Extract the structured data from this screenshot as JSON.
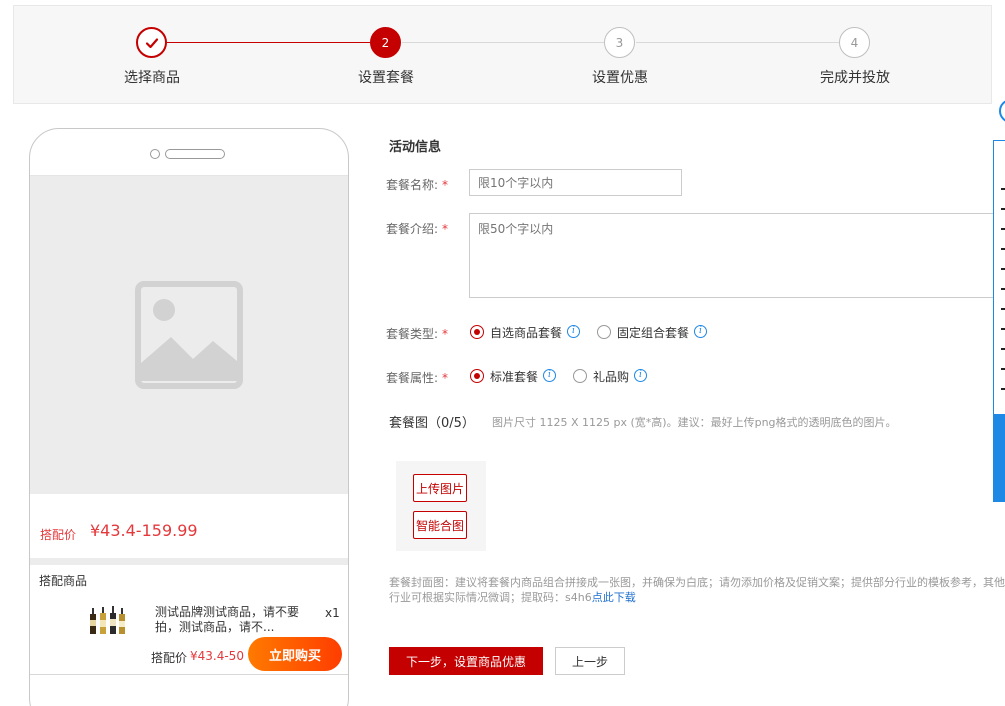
{
  "steps": [
    {
      "num": "",
      "label": "选择商品",
      "state": "done"
    },
    {
      "num": "2",
      "label": "设置套餐",
      "state": "active"
    },
    {
      "num": "3",
      "label": "设置优惠",
      "state": "todo"
    },
    {
      "num": "4",
      "label": "完成并投放",
      "state": "todo"
    }
  ],
  "preview": {
    "price_label": "搭配价",
    "price_value": "¥43.4-159.99",
    "combo_title": "搭配商品",
    "product_name": "测试品牌测试商品，请不要拍，测试商品，请不...",
    "product_qty": "x1",
    "bottom_price_label": "搭配价",
    "bottom_price_value": "¥43.4-50",
    "buy_button": "立即购买"
  },
  "form": {
    "section_title": "活动信息",
    "name_label": "套餐名称:",
    "name_placeholder": "限10个字以内",
    "intro_label": "套餐介绍:",
    "intro_placeholder": "限50个字以内",
    "required_mark": "*",
    "type_label": "套餐类型:",
    "type_options": [
      "自选商品套餐",
      "固定组合套餐"
    ],
    "attr_label": "套餐属性:",
    "attr_options": [
      "标准套餐",
      "礼品购"
    ],
    "info_glyph": "i"
  },
  "images": {
    "title": "套餐图（0/5）",
    "hint": "图片尺寸 1125 X 1125 px (宽*高)。建议：最好上传png格式的透明底色的图片。",
    "upload_button": "上传图片",
    "smart_button": "智能合图",
    "cover_note": "套餐封面图：建议将套餐内商品组合拼接成一张图，并确保为白底；请勿添加价格及促销文案；提供部分行业的模板参考，其他行业可根据实际情况微调；提取码：s4h6",
    "download_link": "点此下载"
  },
  "actions": {
    "next": "下一步，设置商品优惠",
    "prev": "上一步"
  },
  "colors": {
    "brand_red": "#c40000",
    "price_red": "#e4393c",
    "link_blue": "#1e6fcf"
  }
}
